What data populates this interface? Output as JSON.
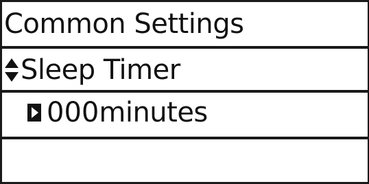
{
  "screen": {
    "title": "Common Settings",
    "selected_item": {
      "label": "Sleep Timer",
      "icon": "up-down-arrows-icon"
    },
    "value": {
      "number": "000",
      "unit": "minutes",
      "icon": "right-triangle-icon"
    },
    "empty_row": ""
  },
  "colors": {
    "background": "#ffffff",
    "foreground": "#111111"
  }
}
